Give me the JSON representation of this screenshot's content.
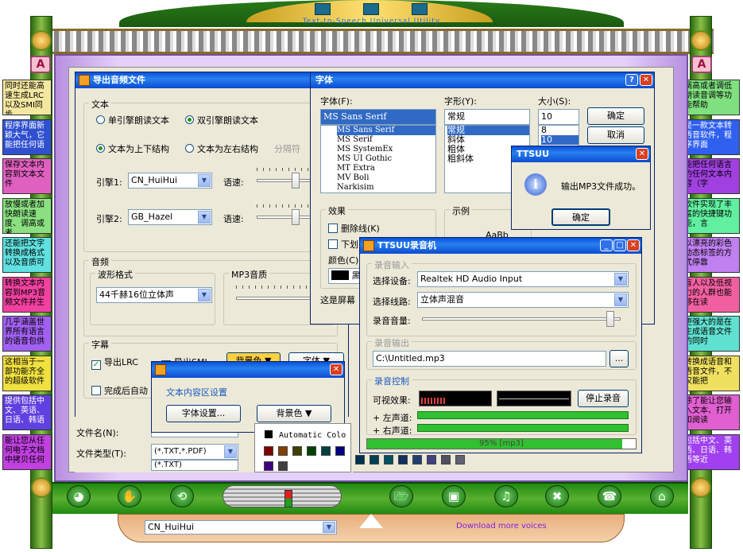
{
  "app": {
    "title": "Text-to-Speech Universal Utility",
    "logo_letter": "A"
  },
  "left_panels": [
    {
      "text": "同时还能高速生成LRC以及SMI同步",
      "bg": "#f4e8a0"
    },
    {
      "text": "程序界面新颖大气，它能把任何语",
      "bg": "#3050d0",
      "fg": "#ffffff"
    },
    {
      "text": "保存文本内容到文本文件",
      "bg": "#e060c0"
    },
    {
      "text": "放慢或者加快朗读速度、调高或者",
      "bg": "#8ae080"
    },
    {
      "text": "还能把文字转换成格式以及音质可",
      "bg": "#60e0e0"
    },
    {
      "text": "转换文本内容到MP3音频文件并生",
      "bg": "#f040a0"
    },
    {
      "text": "几乎涵盖世界所有语言的语音包供",
      "bg": "#a060f0"
    },
    {
      "text": "这相当于一部功能齐全的超级软件",
      "bg": "#f0e040"
    },
    {
      "text": "提供包括中文、英语、日语、韩语",
      "bg": "#6040e0",
      "fg": "#ffffff"
    },
    {
      "text": "能让您从任何电子文档中拷贝任何",
      "bg": "#c040e0"
    }
  ],
  "right_panels": [
    {
      "text": "调高或者调低朗读音调等功能帮助",
      "bg": "#80e080"
    },
    {
      "text": "是一款文本转语音软件，程序界面",
      "bg": "#3060f0",
      "fg": "#ffffff"
    },
    {
      "text": "能把任何语言的任何文本内容（字",
      "bg": "#a040e0"
    },
    {
      "text": "软件实现了丰富的快捷键功能，言",
      "bg": "#60f0a0"
    },
    {
      "text": "以漂亮的彩色动态标签的方式停靠",
      "bg": "#c080f0"
    },
    {
      "text": "盲人以及低视力的人群也能够在读",
      "bg": "#f060a0"
    },
    {
      "text": "更强大的是在生成语音文件的同时",
      "bg": "#60e0d0"
    },
    {
      "text": "转换成语音和语音文件，不仅能把",
      "bg": "#f0e060"
    },
    {
      "text": "除了能让您输入文本、打开和阅读",
      "bg": "#e060d0"
    },
    {
      "text": "包括中文、英语、日语、韩语等近",
      "bg": "#a040f0",
      "fg": "#ffffff"
    }
  ],
  "export_dialog": {
    "title": "导出音频文件",
    "text_group": "文本",
    "radio_single": "单引擎朗读文本",
    "radio_dual": "双引擎朗读文本",
    "radio_topbottom": "文本为上下结构",
    "radio_leftright": "文本为左右结构",
    "separator_label": "分隔符",
    "engine1_label": "引擎1:",
    "engine1_value": "CN_HuiHui",
    "engine2_label": "引擎2:",
    "engine2_value": "GB_Hazel",
    "speed_label": "语速:",
    "audio_group": "音频",
    "waveform_group": "波形格式",
    "waveform_value": "44千赫16位立体声",
    "mp3_group": "MP3音质",
    "subtitle_group": "字幕",
    "export_lrc": "导出LRC",
    "export_smi": "导出SMI",
    "bgcolor_btn": "背景色",
    "font_btn": "字体",
    "auto_label": "完成后自动",
    "filename_label": "文件名(N):",
    "filetype_label": "文件类型(T):",
    "filetype_value": "(*.TXT,*.PDF)",
    "filetype_option": "(*.TXT)"
  },
  "font_dialog": {
    "title": "字体",
    "font_label": "字体(F):",
    "font_value": "MS Sans Serif",
    "fonts": [
      "MS Sans Serif",
      "MS Serif",
      "MS SystemEx",
      "MS UI Gothic",
      "MT Extra",
      "MV Boli",
      "Narkisim"
    ],
    "style_label": "字形(Y):",
    "style_value": "常规",
    "styles": [
      "常规",
      "斜体",
      "粗体",
      "粗斜体"
    ],
    "size_label": "大小(S):",
    "size_value": "10",
    "sizes": [
      "8",
      "10"
    ],
    "ok": "确定",
    "cancel": "取消",
    "effects_group": "效果",
    "strikeout": "删除线(K)",
    "underline": "下划",
    "color_label": "颜色(C)",
    "color_value": "黑",
    "sample_group": "示例",
    "sample_text": "AaBb",
    "script_label": "这是屏幕"
  },
  "ttsuu_msg": {
    "title": "TTSUU",
    "message": "输出MP3文件成功。",
    "ok": "确定"
  },
  "recorder": {
    "title": "TTSUU录音机",
    "input_group": "录音输入",
    "device_label": "选择设备:",
    "device_value": "Realtek HD Audio Input",
    "line_label": "选择线路:",
    "line_value": "立体声混音",
    "volume_label": "录音音量:",
    "output_group": "录音输出",
    "output_path": "C:\\Untitled.mp3",
    "browse": "...",
    "control_group": "录音控制",
    "visual_label": "可视效果:",
    "stop_btn": "停止录音",
    "left_label": "+ 左声道:",
    "right_label": "+ 右声道:",
    "progress_text": "95% [mp3]",
    "progress": 0.95
  },
  "textarea_dialog": {
    "title": "",
    "group": "文本内容区设置",
    "font_btn": "字体设置...",
    "bg_btn": "背景色"
  },
  "color_popup": {
    "automatic": "Automatic Colo"
  },
  "bottom": {
    "voice_value": "CN_HuiHui",
    "download_link": "Download more voices"
  }
}
